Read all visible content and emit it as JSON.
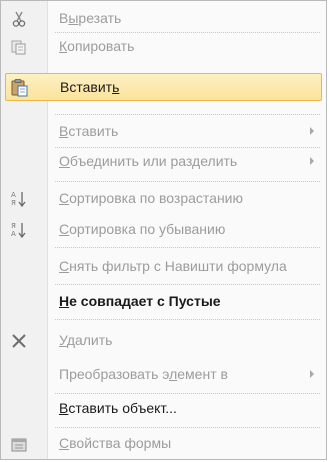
{
  "menu": {
    "items": [
      {
        "label": "Вырезать",
        "access_key_index": 1,
        "enabled": false,
        "icon": "scissors-icon"
      },
      {
        "label": "Копировать",
        "access_key_index": 0,
        "enabled": false,
        "icon": "copy-icon"
      },
      {
        "label": "Вставить",
        "access_key_index": 7,
        "enabled": true,
        "selected": true,
        "icon": "paste-icon"
      },
      {
        "label": "Вставить",
        "access_key_index": 0,
        "enabled": false,
        "submenu": true,
        "icon": ""
      },
      {
        "label": "Объединить или разделить",
        "access_key_index": 0,
        "enabled": false,
        "submenu": true,
        "icon": ""
      },
      {
        "label": "Сортировка по возрастанию",
        "access_key_index": 0,
        "enabled": false,
        "icon": "sort-ascending-icon"
      },
      {
        "label": "Сортировка по убыванию",
        "access_key_index": 0,
        "enabled": false,
        "icon": "sort-descending-icon"
      },
      {
        "label": "Снять фильтр с Навишти формула",
        "access_key_index": 0,
        "enabled": false,
        "icon": ""
      },
      {
        "label": "Не совпадает с Пустые",
        "access_key_index": 0,
        "enabled": true,
        "bold": true,
        "icon": ""
      },
      {
        "label": "Удалить",
        "access_key_index": 0,
        "enabled": false,
        "icon": "delete-icon"
      },
      {
        "label": "Преобразовать элемент в",
        "access_key_index": 15,
        "enabled": false,
        "submenu": true,
        "icon": ""
      },
      {
        "label": "Вставить объект...",
        "access_key_index": 0,
        "enabled": true,
        "icon": ""
      },
      {
        "label": "Свойства формы",
        "access_key_index": 0,
        "enabled": false,
        "icon": "form-properties-icon"
      }
    ]
  },
  "colors": {
    "selected_bg": "#fbe39a",
    "selected_border": "#e9b84b",
    "enabled_text": "#1a1a1a",
    "disabled_text": "#9c9c9c"
  }
}
